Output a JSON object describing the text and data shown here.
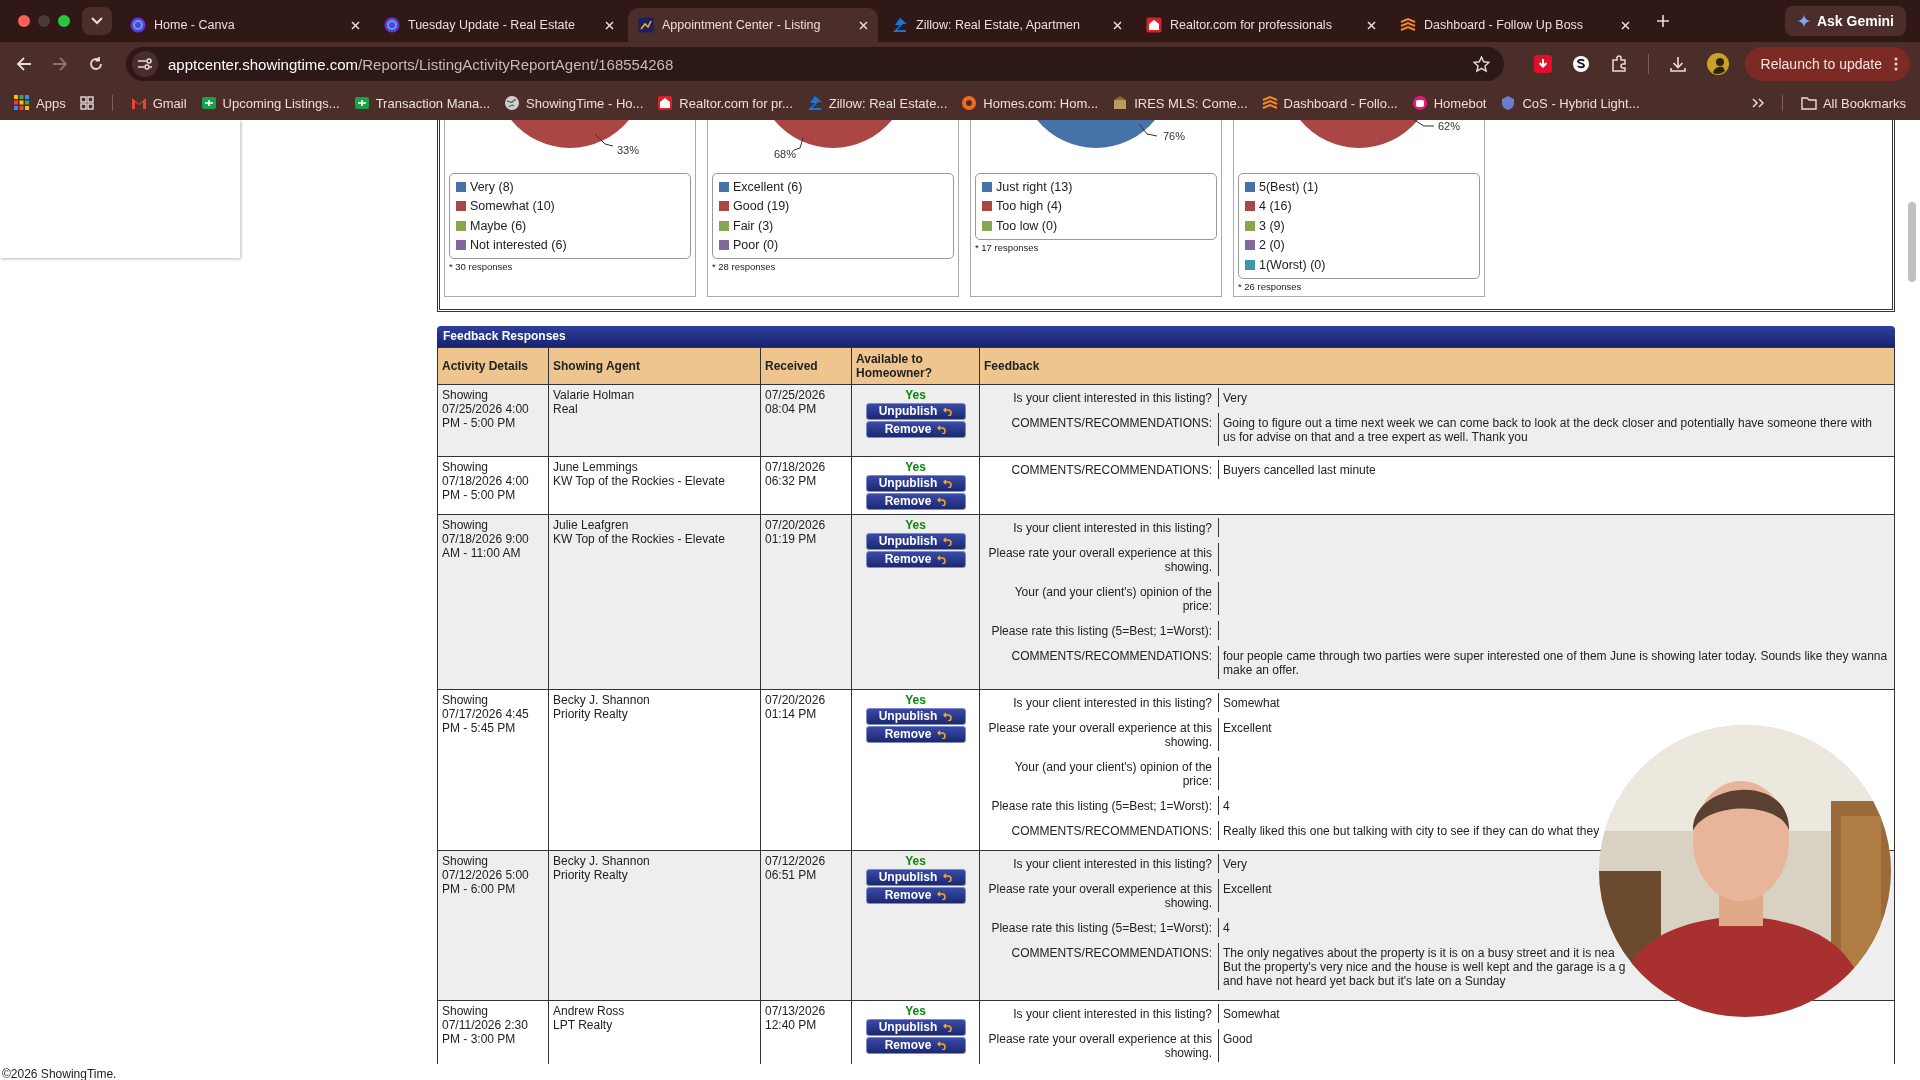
{
  "browser": {
    "tabs": [
      {
        "title": "Home - Canva",
        "kind": "canva",
        "selected": false
      },
      {
        "title": "Tuesday Update - Real Estate",
        "kind": "canva",
        "selected": false
      },
      {
        "title": "Appointment Center - Listing",
        "kind": "chart",
        "selected": true
      },
      {
        "title": "Zillow: Real Estate, Apartmen",
        "kind": "zillow",
        "selected": false
      },
      {
        "title": "Realtor.com for professionals",
        "kind": "realtor",
        "selected": false
      },
      {
        "title": "Dashboard - Follow Up Boss",
        "kind": "layers",
        "selected": false
      }
    ],
    "ask_button": "Ask Gemini",
    "address": {
      "host": "apptcenter.showingtime.com",
      "path": "/Reports/ListingActivityReportAgent/168554268"
    },
    "relaunch_button": "Relaunch to update",
    "bookmarks": [
      {
        "label": "Apps",
        "kind": "apps"
      },
      {
        "label": "Gmail",
        "kind": "gmail"
      },
      {
        "label": "Upcoming Listings...",
        "kind": "sheet"
      },
      {
        "label": "Transaction Mana...",
        "kind": "sheet"
      },
      {
        "label": "ShowingTime - Ho...",
        "kind": "globe"
      },
      {
        "label": "Realtor.com for pr...",
        "kind": "realtor"
      },
      {
        "label": "Zillow: Real Estate...",
        "kind": "zillow"
      },
      {
        "label": "Homes.com: Hom...",
        "kind": "homes"
      },
      {
        "label": "IRES MLS: Come...",
        "kind": "mls"
      },
      {
        "label": "Dashboard - Follo...",
        "kind": "layers"
      },
      {
        "label": "Homebot",
        "kind": "bot"
      },
      {
        "label": "CoS - Hybrid Light...",
        "kind": "shield"
      }
    ],
    "all_bookmarks": "All Bookmarks"
  },
  "survey_cards": [
    {
      "percent": "33%",
      "responses": "* 30 responses",
      "legend": [
        {
          "label": "Very (8)",
          "color": "#4572a7"
        },
        {
          "label": "Somewhat (10)",
          "color": "#aa4643"
        },
        {
          "label": "Maybe (6)",
          "color": "#89a54e"
        },
        {
          "label": "Not interested (6)",
          "color": "#80699b"
        }
      ]
    },
    {
      "percent": "68%",
      "responses": "* 28 responses",
      "legend": [
        {
          "label": "Excellent (6)",
          "color": "#4572a7"
        },
        {
          "label": "Good (19)",
          "color": "#aa4643"
        },
        {
          "label": "Fair (3)",
          "color": "#89a54e"
        },
        {
          "label": "Poor (0)",
          "color": "#80699b"
        }
      ]
    },
    {
      "percent": "76%",
      "responses": "* 17 responses",
      "legend": [
        {
          "label": "Just right (13)",
          "color": "#4572a7"
        },
        {
          "label": "Too high (4)",
          "color": "#aa4643"
        },
        {
          "label": "Too low (0)",
          "color": "#89a54e"
        }
      ]
    },
    {
      "percent": "62%",
      "responses": "* 26 responses",
      "legend": [
        {
          "label": "5(Best) (1)",
          "color": "#4572a7"
        },
        {
          "label": "4 (16)",
          "color": "#aa4643"
        },
        {
          "label": "3 (9)",
          "color": "#89a54e"
        },
        {
          "label": "2 (0)",
          "color": "#80699b"
        },
        {
          "label": "1(Worst) (0)",
          "color": "#3d96ae"
        }
      ]
    }
  ],
  "feedback": {
    "title": "Feedback Responses",
    "columns": [
      "Activity Details",
      "Showing Agent",
      "Received",
      "Available to Homeowner?",
      "Feedback"
    ],
    "rows": [
      {
        "activity": [
          "Showing",
          "07/25/2026 4:00",
          "PM - 5:00 PM"
        ],
        "agent": [
          "Valarie Holman",
          "Real"
        ],
        "received": [
          "07/25/2026",
          "08:04 PM"
        ],
        "available": "Yes",
        "buttons": [
          "Unpublish",
          "Remove"
        ],
        "items": [
          {
            "q": "Is your client interested in this listing?",
            "a": [
              "Very"
            ]
          },
          {
            "q": "COMMENTS/RECOMMENDATIONS:",
            "a": [
              "Going to figure out a time next week we can come back to look at the deck closer and potentially have someone there with us for advise on that and a tree expert as well. Thank you"
            ]
          }
        ]
      },
      {
        "activity": [
          "Showing",
          "07/18/2026 4:00",
          "PM - 5:00 PM"
        ],
        "agent": [
          "June Lemmings",
          "KW Top of the Rockies - Elevate"
        ],
        "received": [
          "07/18/2026",
          "06:32 PM"
        ],
        "available": "Yes",
        "buttons": [
          "Unpublish",
          "Remove"
        ],
        "items": [
          {
            "q": "COMMENTS/RECOMMENDATIONS:",
            "a": [
              "Buyers cancelled last minute"
            ]
          }
        ]
      },
      {
        "activity": [
          "Showing",
          "07/18/2026 9:00",
          "AM - 11:00 AM"
        ],
        "agent": [
          "Julie Leafgren",
          "KW Top of the Rockies - Elevate"
        ],
        "received": [
          "07/20/2026",
          "01:19 PM"
        ],
        "available": "Yes",
        "buttons": [
          "Unpublish",
          "Remove"
        ],
        "items": [
          {
            "q": "Is your client interested in this listing?"
          },
          {
            "q": [
              "Please rate your overall experience at this",
              "showing."
            ]
          },
          {
            "q": [
              "Your (and your client's) opinion of the",
              "price:"
            ]
          },
          {
            "q": "Please rate this listing (5=Best; 1=Worst):"
          },
          {
            "q": "COMMENTS/RECOMMENDATIONS:",
            "a": [
              "four people came through two parties were super interested one of them June is showing later today. Sounds like they wanna make an offer."
            ]
          }
        ]
      },
      {
        "activity": [
          "Showing",
          "07/17/2026 4:45",
          "PM - 5:45 PM"
        ],
        "agent": [
          "Becky J. Shannon",
          "Priority Realty"
        ],
        "received": [
          "07/20/2026",
          "01:14 PM"
        ],
        "available": "Yes",
        "buttons": [
          "Unpublish",
          "Remove"
        ],
        "items": [
          {
            "q": "Is your client interested in this listing?",
            "a": [
              "Somewhat"
            ]
          },
          {
            "q": [
              "Please rate your overall experience at this",
              "showing."
            ],
            "a": [
              "Excellent"
            ]
          },
          {
            "q": [
              "Your (and your client's) opinion of the",
              "price:"
            ]
          },
          {
            "q": "Please rate this listing (5=Best; 1=Worst):",
            "a": [
              "4"
            ]
          },
          {
            "q": "COMMENTS/RECOMMENDATIONS:",
            "a": [
              "Really liked this one but talking with city to see if they can do what they"
            ]
          }
        ]
      },
      {
        "activity": [
          "Showing",
          "07/12/2026 5:00",
          "PM - 6:00 PM"
        ],
        "agent": [
          "Becky J. Shannon",
          "Priority Realty"
        ],
        "received": [
          "07/12/2026",
          "06:51 PM"
        ],
        "available": "Yes",
        "buttons": [
          "Unpublish",
          "Remove"
        ],
        "items": [
          {
            "q": "Is your client interested in this listing?",
            "a": [
              "Very"
            ]
          },
          {
            "q": [
              "Please rate your overall experience at this",
              "showing."
            ],
            "a": [
              "Excellent"
            ]
          },
          {
            "q": "Please rate this listing (5=Best; 1=Worst):",
            "a": [
              "4"
            ]
          },
          {
            "q": "COMMENTS/RECOMMENDATIONS:",
            "a": [
              "The only negatives about the property is it is on a busy street and it is nea",
              "But the property's very nice and the house is well kept and the garage is a g",
              "and have not heard yet back but it's late on a Sunday"
            ]
          }
        ]
      },
      {
        "activity": [
          "Showing",
          "07/11/2026 2:30",
          "PM - 3:00 PM"
        ],
        "agent": [
          "Andrew Ross",
          "LPT Realty"
        ],
        "received": [
          "07/13/2026",
          "12:40 PM"
        ],
        "available": "Yes",
        "buttons": [
          "Unpublish",
          "Remove"
        ],
        "items": [
          {
            "q": "Is your client interested in this listing?",
            "a": [
              "Somewhat"
            ]
          },
          {
            "q": [
              "Please rate your overall experience at this",
              "showing."
            ],
            "a": [
              "Good"
            ]
          }
        ]
      }
    ]
  },
  "footer": "©2026 ShowingTime."
}
